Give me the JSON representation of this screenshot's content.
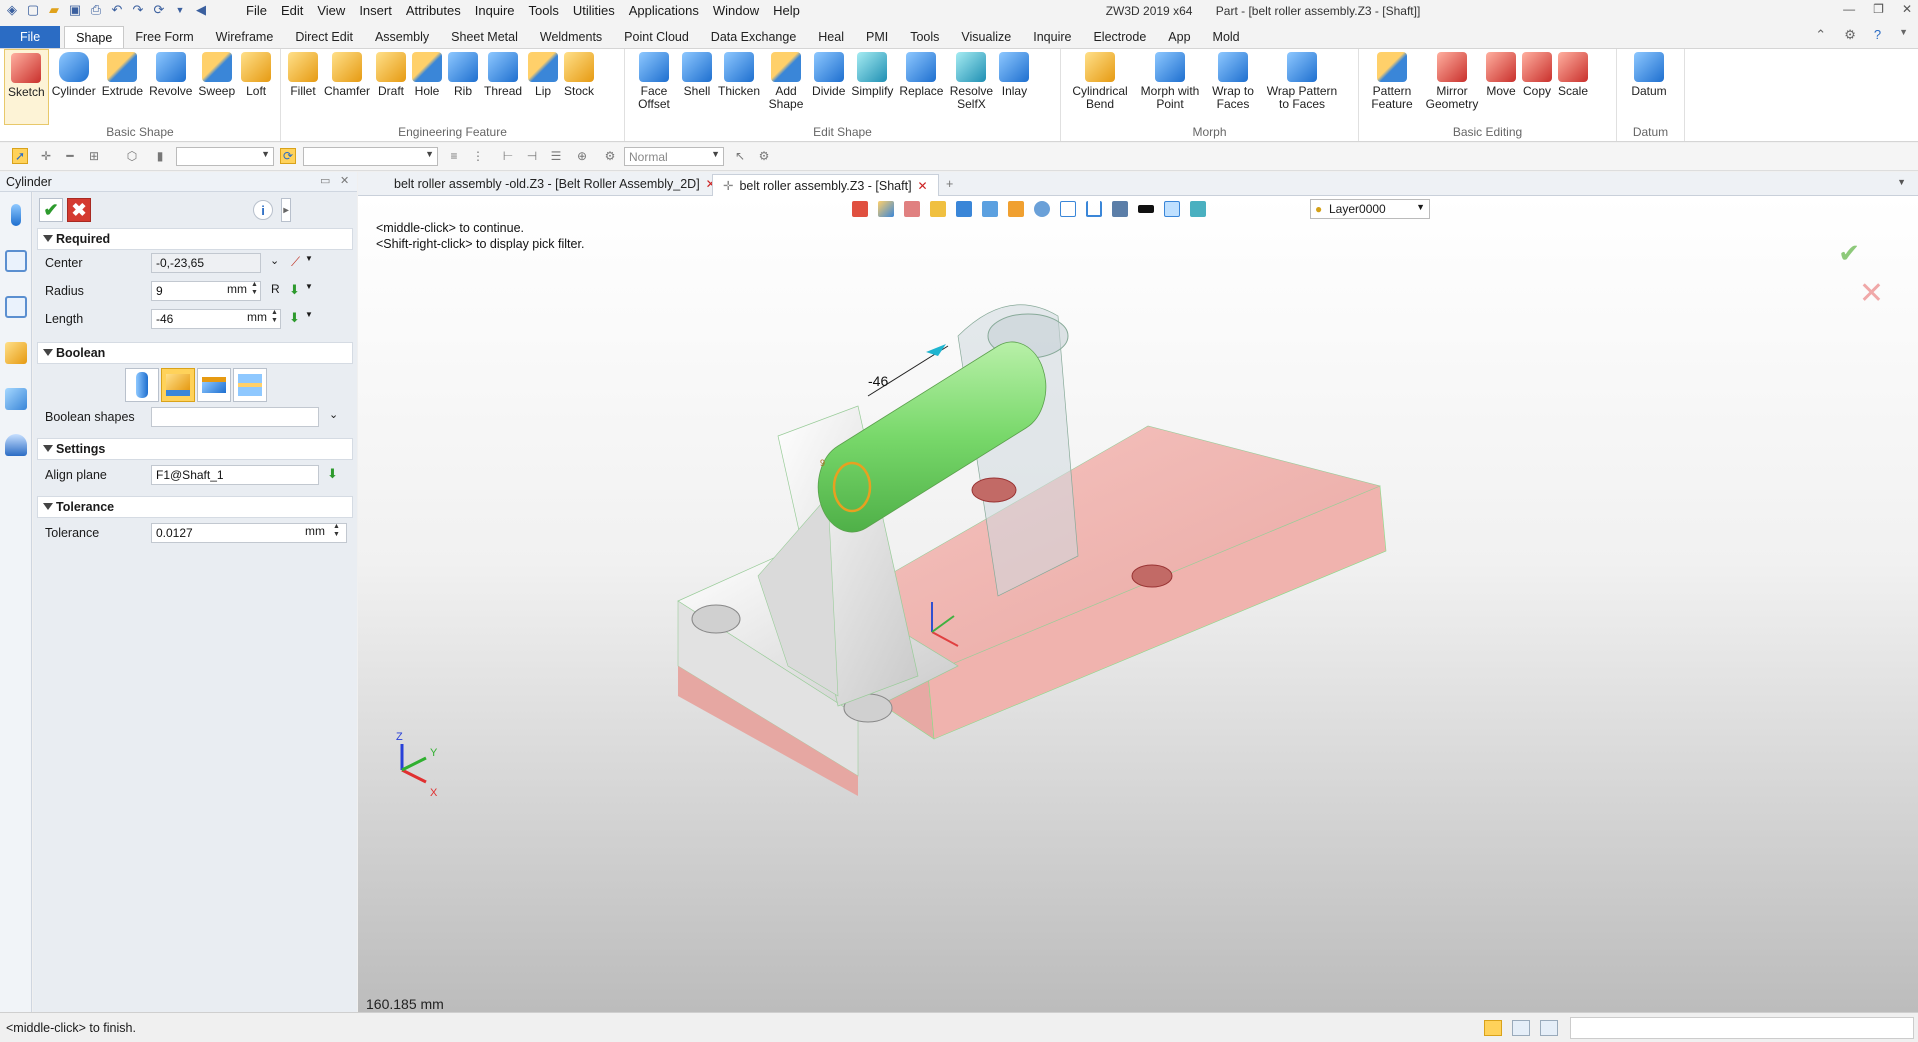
{
  "titlebar": {
    "menus": [
      "File",
      "Edit",
      "View",
      "Insert",
      "Attributes",
      "Inquire",
      "Tools",
      "Utilities",
      "Applications",
      "Window",
      "Help"
    ],
    "app_version": "ZW3D 2019  x64",
    "doc_title": "Part - [belt roller assembly.Z3 - [Shaft]]"
  },
  "ribbon_tabs": {
    "file": "File",
    "tabs": [
      "Shape",
      "Free Form",
      "Wireframe",
      "Direct Edit",
      "Assembly",
      "Sheet Metal",
      "Weldments",
      "Point Cloud",
      "Data Exchange",
      "Heal",
      "PMI",
      "Tools",
      "Visualize",
      "Inquire",
      "Electrode",
      "App",
      "Mold"
    ],
    "active": "Shape"
  },
  "ribbon": {
    "groups": [
      {
        "label": "Basic Shape",
        "buttons": [
          "Sketch",
          "Cylinder",
          "Extrude",
          "Revolve",
          "Sweep",
          "Loft"
        ]
      },
      {
        "label": "Engineering Feature",
        "buttons": [
          "Fillet",
          "Chamfer",
          "Draft",
          "Hole",
          "Rib",
          "Thread",
          "Lip",
          "Stock"
        ]
      },
      {
        "label": "Edit Shape",
        "buttons": [
          "Face Offset",
          "Shell",
          "Thicken",
          "Add Shape",
          "Divide",
          "Simplify",
          "Replace",
          "Resolve SelfX",
          "Inlay"
        ]
      },
      {
        "label": "Morph",
        "buttons": [
          "Cylindrical Bend",
          "Morph with Point",
          "Wrap to Faces",
          "Wrap Pattern to Faces"
        ]
      },
      {
        "label": "Basic Editing",
        "buttons": [
          "Pattern Feature",
          "Mirror Geometry",
          "Move",
          "Copy",
          "Scale"
        ]
      },
      {
        "label": "Datum",
        "buttons": [
          "Datum"
        ]
      }
    ]
  },
  "toolbar2": {
    "filter_value": "Normal"
  },
  "panel": {
    "title": "Cylinder",
    "sections": {
      "required": "Required",
      "boolean": "Boolean",
      "settings": "Settings",
      "tolerance": "Tolerance"
    },
    "center": {
      "label": "Center",
      "value": "-0,-23,65"
    },
    "radius": {
      "label": "Radius",
      "value": "9",
      "unit": "mm",
      "suffix": "R"
    },
    "length": {
      "label": "Length",
      "value": "-46",
      "unit": "mm"
    },
    "boolean_shapes": {
      "label": "Boolean shapes",
      "value": ""
    },
    "align_plane": {
      "label": "Align plane",
      "value": "F1@Shaft_1"
    },
    "tolerance": {
      "label": "Tolerance",
      "value": "0.0127",
      "unit": "mm"
    }
  },
  "doc_tabs": [
    {
      "label": "belt roller assembly -old.Z3 - [Belt Roller Assembly_2D]",
      "active": false
    },
    {
      "label": "belt roller assembly.Z3 - [Shaft]",
      "active": true
    }
  ],
  "viewport": {
    "hint_line1": "<middle-click> to continue.",
    "hint_line2": "<Shift-right-click> to display pick filter.",
    "layer": "Layer0000",
    "dimension": "-46",
    "radius_label": "9",
    "scale_text": "160.185 mm"
  },
  "statusbar": {
    "message": "<middle-click> to finish."
  }
}
